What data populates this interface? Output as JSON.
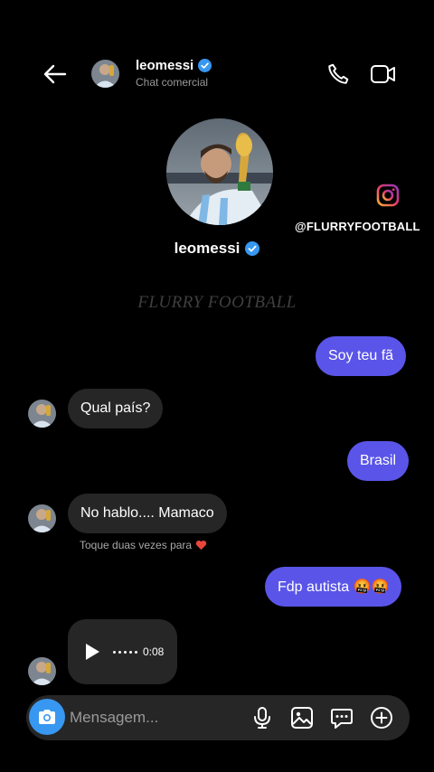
{
  "header": {
    "username": "leomessi",
    "subtitle": "Chat comercial"
  },
  "profile": {
    "username": "leomessi"
  },
  "watermark": {
    "handle": "@FLURRYFOOTBALL",
    "center_text": "FLURRY FOOTBALL"
  },
  "messages": [
    {
      "from": "me",
      "text": "Soy teu fã"
    },
    {
      "from": "them",
      "text": "Qual país?"
    },
    {
      "from": "me",
      "text": "Brasil"
    },
    {
      "from": "them",
      "text": "No hablo.... Mamaco"
    },
    {
      "from": "me",
      "text": "Fdp autista 🤬🤬"
    }
  ],
  "tap_hint": "Toque duas vezes para",
  "voice_message": {
    "duration": "0:08"
  },
  "composer": {
    "placeholder": "Mensagem..."
  },
  "colors": {
    "sent_bubble": "#5a55e8",
    "received_bubble": "#262626",
    "verified": "#3897f0",
    "camera_button": "#3897f0"
  },
  "icons": [
    "back-arrow-icon",
    "verified-icon",
    "phone-icon",
    "video-camera-icon",
    "instagram-icon",
    "heart-icon",
    "play-icon",
    "camera-icon",
    "microphone-icon",
    "gallery-icon",
    "sticker-icon",
    "plus-icon"
  ]
}
